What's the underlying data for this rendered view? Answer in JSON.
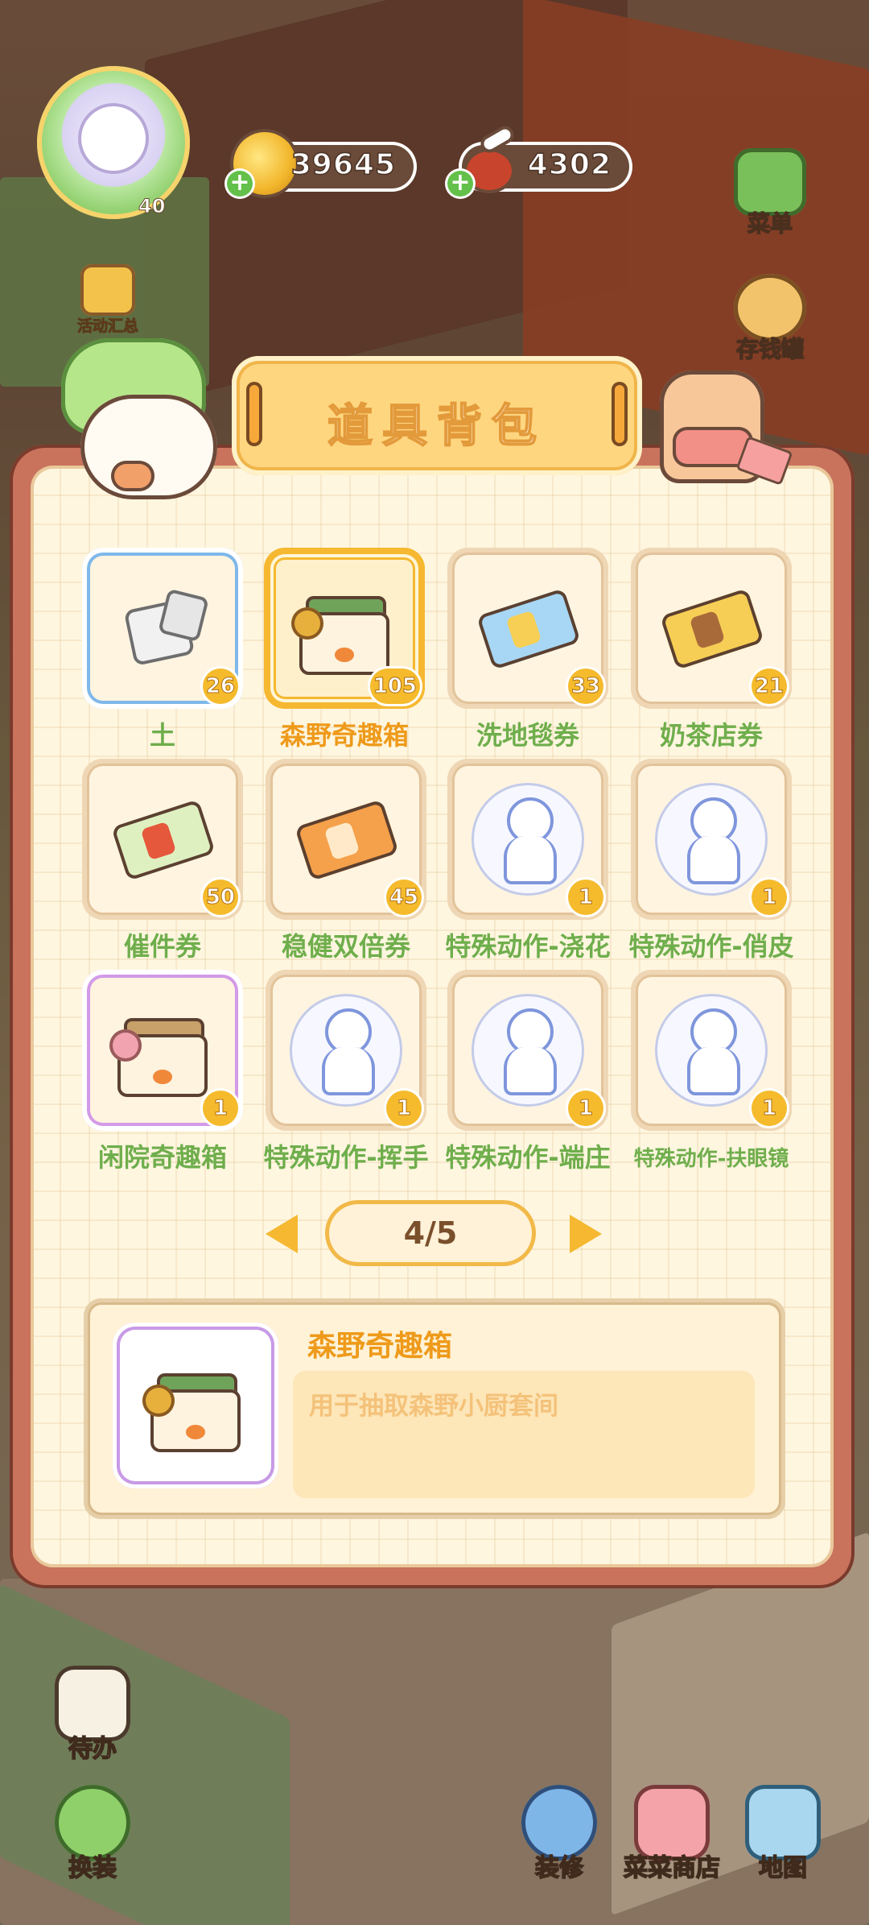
{
  "hud": {
    "level": "40",
    "event_label": "活动汇总",
    "coins": "39645",
    "meat": "4302",
    "plus": "+",
    "menu_label": "菜单",
    "piggy_label": "存钱罐"
  },
  "panel": {
    "title": "道具背包"
  },
  "items": [
    {
      "name": "土",
      "count": "26"
    },
    {
      "name": "森野奇趣箱",
      "count": "105"
    },
    {
      "name": "洗地毯券",
      "count": "33"
    },
    {
      "name": "奶茶店券",
      "count": "21"
    },
    {
      "name": "催件券",
      "count": "50"
    },
    {
      "name": "稳健双倍券",
      "count": "45"
    },
    {
      "name": "特殊动作-浇花",
      "count": "1"
    },
    {
      "name": "特殊动作-俏皮",
      "count": "1"
    },
    {
      "name": "闲院奇趣箱",
      "count": "1"
    },
    {
      "name": "特殊动作-挥手",
      "count": "1"
    },
    {
      "name": "特殊动作-端庄",
      "count": "1"
    },
    {
      "name": "特殊动作-扶眼镜",
      "count": "1"
    }
  ],
  "pager": {
    "text": "4/5"
  },
  "detail": {
    "name": "森野奇趣箱",
    "description": "用于抽取森野小厨套间"
  },
  "dock": {
    "todo": "待办",
    "dress": "换装",
    "decorate": "装修",
    "shop": "菜菜商店",
    "map": "地图"
  },
  "colors": {
    "accent": "#f5b830",
    "item_name_green": "#6fae4c",
    "selected_name_orange": "#ee9a1a",
    "panel_frame": "#c9725c"
  }
}
